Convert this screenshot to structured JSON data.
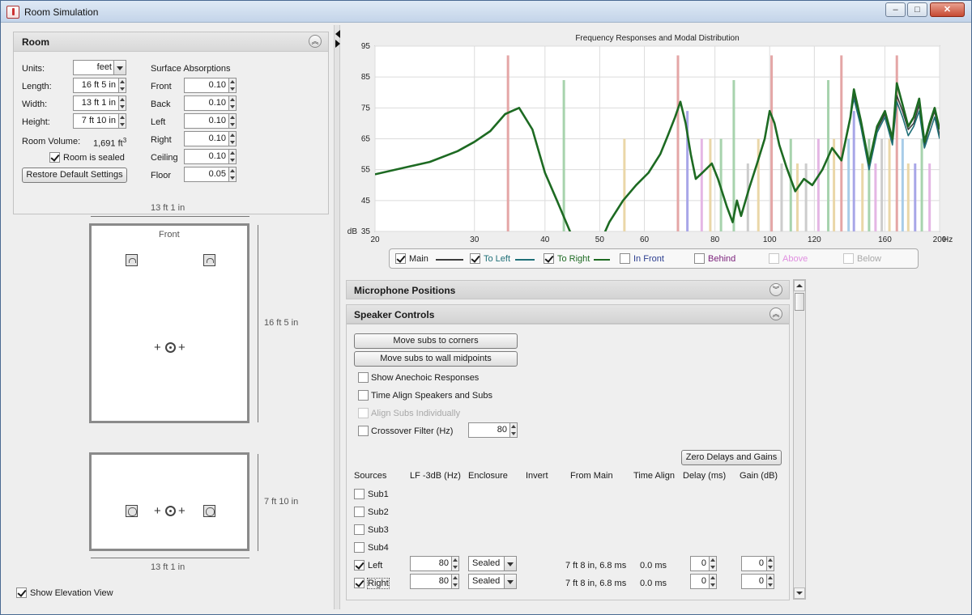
{
  "window": {
    "title": "Room Simulation",
    "minimize": "–",
    "maximize": "□",
    "close": "✕"
  },
  "room": {
    "title": "Room",
    "units_label": "Units:",
    "units_value": "feet",
    "length_label": "Length:",
    "length_value": "16 ft 5 in",
    "width_label": "Width:",
    "width_value": "13 ft 1 in",
    "height_label": "Height:",
    "height_value": "7 ft 10 in",
    "volume_label": "Room Volume:",
    "volume_value": "1,691 ft",
    "volume_sup": "3",
    "sealed_label": "Room is sealed",
    "restore_label": "Restore Default Settings",
    "absorptions_title": "Surface Absorptions",
    "surfaces": [
      {
        "label": "Front",
        "value": "0.10"
      },
      {
        "label": "Back",
        "value": "0.10"
      },
      {
        "label": "Left",
        "value": "0.10"
      },
      {
        "label": "Right",
        "value": "0.10"
      },
      {
        "label": "Ceiling",
        "value": "0.10"
      },
      {
        "label": "Floor",
        "value": "0.05"
      }
    ]
  },
  "plan": {
    "top_width": "13 ft 1 in",
    "front_label": "Front",
    "length_dim": "16 ft 5 in",
    "height_dim": "7 ft 10 in",
    "bottom_width": "13 ft 1 in",
    "show_elevation_label": "Show Elevation View"
  },
  "chart_data": {
    "type": "line",
    "title": "Frequency Responses and Modal Distribution",
    "y_unit_label": "dB",
    "x_unit_label": "Hz",
    "x_scale": "log",
    "xlim": [
      20,
      200
    ],
    "ylim": [
      35,
      95
    ],
    "x_ticks": [
      20,
      30,
      40,
      50,
      60,
      80,
      100,
      120,
      160,
      200
    ],
    "y_ticks": [
      35,
      45,
      55,
      65,
      75,
      85,
      95
    ],
    "grid": true,
    "series": [
      {
        "name": "Main",
        "color": "#3c3c3c",
        "x": [
          20,
          25,
          28,
          30,
          32,
          34,
          36,
          38,
          40,
          42,
          45,
          48,
          50,
          52,
          55,
          58,
          61,
          64,
          66,
          68,
          69.5,
          71,
          72.5,
          74,
          76,
          79,
          81,
          84,
          86,
          87.5,
          89,
          92,
          95,
          98,
          100,
          102,
          104,
          107,
          111,
          115,
          119,
          124,
          129,
          134,
          139,
          141,
          145,
          150,
          155,
          160,
          165,
          168,
          172,
          176,
          180,
          184,
          188,
          192,
          196,
          200
        ],
        "y": [
          53.5,
          57.5,
          61,
          64,
          67.5,
          73,
          75,
          68,
          54,
          45,
          32,
          28,
          31,
          38,
          45,
          50,
          54,
          60,
          66,
          72,
          77,
          70,
          60,
          52,
          54,
          57,
          52,
          43,
          38,
          45,
          40,
          49,
          57,
          65,
          74,
          70,
          63,
          56,
          48,
          52,
          50,
          55,
          62,
          58,
          72,
          79,
          70,
          56,
          68,
          73,
          64,
          79,
          74,
          68,
          70,
          76,
          63,
          69,
          74,
          66
        ]
      },
      {
        "name": "To Left",
        "color": "#1f6f77",
        "x": [
          20,
          25,
          28,
          30,
          32,
          34,
          36,
          38,
          40,
          42,
          45,
          48,
          50,
          52,
          55,
          58,
          61,
          64,
          66,
          68,
          69.5,
          71,
          72.5,
          74,
          76,
          79,
          81,
          84,
          86,
          87.5,
          89,
          92,
          95,
          98,
          100,
          102,
          104,
          107,
          111,
          115,
          119,
          124,
          129,
          134,
          139,
          141,
          145,
          150,
          155,
          160,
          165,
          168,
          172,
          176,
          180,
          184,
          188,
          192,
          196,
          200
        ],
        "y": [
          53.5,
          57.5,
          61,
          64,
          67.5,
          73,
          75,
          68,
          54,
          45,
          32,
          28,
          31,
          38,
          45,
          50,
          54,
          60,
          66,
          72,
          77,
          70,
          60,
          52,
          54,
          57,
          52,
          43,
          38,
          45,
          40,
          49,
          57,
          65,
          74,
          70,
          63,
          56,
          48,
          52,
          50,
          55,
          62,
          58,
          72,
          78,
          69,
          55,
          67,
          72,
          63,
          77,
          72,
          66,
          69,
          74,
          62,
          67,
          72,
          65
        ]
      },
      {
        "name": "To Right",
        "color": "#1d6a22",
        "x": [
          20,
          25,
          28,
          30,
          32,
          34,
          36,
          38,
          40,
          42,
          45,
          48,
          50,
          52,
          55,
          58,
          61,
          64,
          66,
          68,
          69.5,
          71,
          72.5,
          74,
          76,
          79,
          81,
          84,
          86,
          87.5,
          89,
          92,
          95,
          98,
          100,
          102,
          104,
          107,
          111,
          115,
          119,
          124,
          129,
          134,
          139,
          141,
          145,
          150,
          155,
          160,
          165,
          168,
          172,
          176,
          180,
          184,
          188,
          192,
          196,
          200
        ],
        "y": [
          53.5,
          57.5,
          61,
          64,
          67.5,
          73,
          75,
          68,
          54,
          45,
          32,
          28,
          31,
          38,
          45,
          50,
          54,
          60,
          66,
          72,
          77,
          70,
          60,
          52,
          54,
          57,
          52,
          43,
          38,
          45,
          40,
          49,
          57,
          65,
          74,
          70,
          63,
          56,
          48,
          52,
          50,
          55,
          62,
          58,
          72,
          81,
          71,
          57,
          69,
          74,
          65,
          83,
          76,
          69,
          72,
          78,
          64,
          70,
          75,
          68
        ]
      }
    ],
    "modes": [
      {
        "f": 34.4,
        "h": 92,
        "c": "#e4a6a6"
      },
      {
        "f": 43.2,
        "h": 84,
        "c": "#a7d3ad"
      },
      {
        "f": 55.3,
        "h": 65,
        "c": "#ead7a8"
      },
      {
        "f": 68.8,
        "h": 92,
        "c": "#e4a6a6"
      },
      {
        "f": 71.5,
        "h": 74,
        "c": "#a8a6e8"
      },
      {
        "f": 75.8,
        "h": 65,
        "c": "#e4b6e4"
      },
      {
        "f": 78.5,
        "h": 65,
        "c": "#ead7a8"
      },
      {
        "f": 82,
        "h": 65,
        "c": "#a7d3ad"
      },
      {
        "f": 86.4,
        "h": 84,
        "c": "#a7d3ad"
      },
      {
        "f": 91.5,
        "h": 57,
        "c": "#cccccc"
      },
      {
        "f": 95.5,
        "h": 65,
        "c": "#ead7a8"
      },
      {
        "f": 100.8,
        "h": 92,
        "c": "#e4a6a6"
      },
      {
        "f": 105,
        "h": 57,
        "c": "#cccccc"
      },
      {
        "f": 109,
        "h": 65,
        "c": "#a7d3ad"
      },
      {
        "f": 112,
        "h": 57,
        "c": "#ead7a8"
      },
      {
        "f": 116,
        "h": 57,
        "c": "#cccccc"
      },
      {
        "f": 122,
        "h": 65,
        "c": "#e4b6e4"
      },
      {
        "f": 127,
        "h": 84,
        "c": "#a7d3ad"
      },
      {
        "f": 130,
        "h": 65,
        "c": "#ead7a8"
      },
      {
        "f": 134,
        "h": 92,
        "c": "#e4a6a6"
      },
      {
        "f": 138,
        "h": 65,
        "c": "#a8cce8"
      },
      {
        "f": 141,
        "h": 74,
        "c": "#a8a6e8"
      },
      {
        "f": 146,
        "h": 57,
        "c": "#ead7a8"
      },
      {
        "f": 150,
        "h": 65,
        "c": "#a7d3ad"
      },
      {
        "f": 154,
        "h": 57,
        "c": "#e4b6e4"
      },
      {
        "f": 158,
        "h": 65,
        "c": "#cccccc"
      },
      {
        "f": 163,
        "h": 65,
        "c": "#ead7a8"
      },
      {
        "f": 168,
        "h": 92,
        "c": "#e4a6a6"
      },
      {
        "f": 172,
        "h": 65,
        "c": "#a8cce8"
      },
      {
        "f": 176,
        "h": 57,
        "c": "#ead7a8"
      },
      {
        "f": 181,
        "h": 57,
        "c": "#a8a6e8"
      },
      {
        "f": 186,
        "h": 65,
        "c": "#a7d3ad"
      },
      {
        "f": 192,
        "h": 57,
        "c": "#e4b6e4"
      }
    ]
  },
  "legend": [
    {
      "label": "Main",
      "checked": true,
      "color": "#222222",
      "line": "#3c3c3c"
    },
    {
      "label": "To Left",
      "checked": true,
      "color": "#1f6f77",
      "line": "#1f6f77"
    },
    {
      "label": "To Right",
      "checked": true,
      "color": "#1d6a22",
      "line": "#1d6a22"
    },
    {
      "label": "In Front",
      "checked": false,
      "color": "#2b3d8f",
      "line": ""
    },
    {
      "label": "Behind",
      "checked": false,
      "color": "#7a1f7a",
      "line": ""
    },
    {
      "label": "Above",
      "checked": false,
      "color": "#e08fe0",
      "line": ""
    },
    {
      "label": "Below",
      "checked": false,
      "color": "#a8a8a8",
      "line": ""
    }
  ],
  "mic_section": {
    "title": "Microphone Positions"
  },
  "speaker_section": {
    "title": "Speaker Controls",
    "corners_btn": "Move subs to corners",
    "midpoints_btn": "Move subs to wall midpoints",
    "anechoic_label": "Show Anechoic Responses",
    "timealign_label": "Time Align Speakers and Subs",
    "alignsubs_label": "Align Subs Individually",
    "crossover_label": "Crossover Filter (Hz)",
    "crossover_value": "80",
    "zero_btn": "Zero Delays and Gains",
    "columns": [
      "Sources",
      "LF -3dB (Hz)",
      "Enclosure",
      "Invert",
      "From Main",
      "Time Align",
      "Delay (ms)",
      "Gain (dB)"
    ],
    "sources": [
      {
        "name": "Sub1",
        "checked": false
      },
      {
        "name": "Sub2",
        "checked": false
      },
      {
        "name": "Sub3",
        "checked": false
      },
      {
        "name": "Sub4",
        "checked": false
      },
      {
        "name": "Left",
        "checked": true,
        "lf": "80",
        "enclosure": "Sealed",
        "from_main": "7 ft 8 in, 6.8 ms",
        "time_align": "0.0 ms",
        "delay": "0",
        "gain": "0"
      },
      {
        "name": "Right",
        "checked": true,
        "lf": "80",
        "enclosure": "Sealed",
        "from_main": "7 ft 8 in, 6.8 ms",
        "time_align": "0.0 ms",
        "delay": "0",
        "gain": "0"
      }
    ]
  }
}
